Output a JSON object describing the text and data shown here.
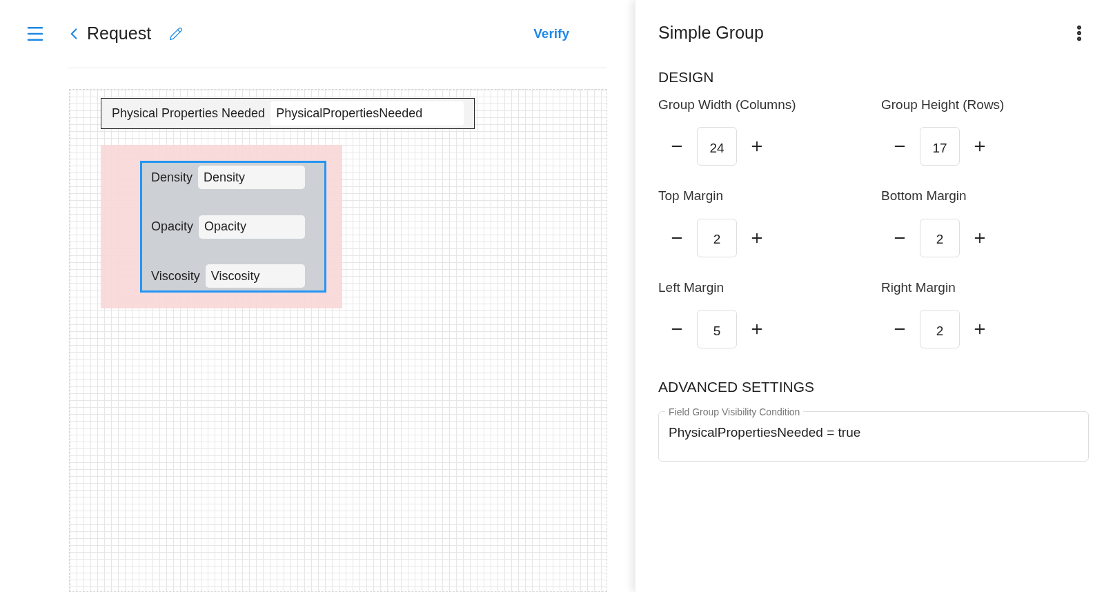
{
  "header": {
    "title": "Request",
    "action": "Verify"
  },
  "canvas": {
    "top_field": {
      "label": "Physical Properties Needed",
      "value": "PhysicalPropertiesNeeded"
    },
    "group": {
      "selected": true,
      "fields": [
        {
          "label": "Density",
          "value": "Density"
        },
        {
          "label": "Opacity",
          "value": "Opacity"
        },
        {
          "label": "Viscosity",
          "value": "Viscosity"
        }
      ]
    }
  },
  "panel": {
    "title": "Simple Group",
    "design_heading": "DESIGN",
    "steppers": [
      {
        "label": "Group Width (Columns)",
        "value": "24"
      },
      {
        "label": "Group Height (Rows)",
        "value": "17"
      },
      {
        "label": "Top Margin",
        "value": "2"
      },
      {
        "label": "Bottom Margin",
        "value": "2"
      },
      {
        "label": "Left Margin",
        "value": "5"
      },
      {
        "label": "Right Margin",
        "value": "2"
      }
    ],
    "advanced_heading": "ADVANCED SETTINGS",
    "condition": {
      "label": "Field Group Visibility Condition",
      "value": "PhysicalPropertiesNeeded = true"
    }
  }
}
